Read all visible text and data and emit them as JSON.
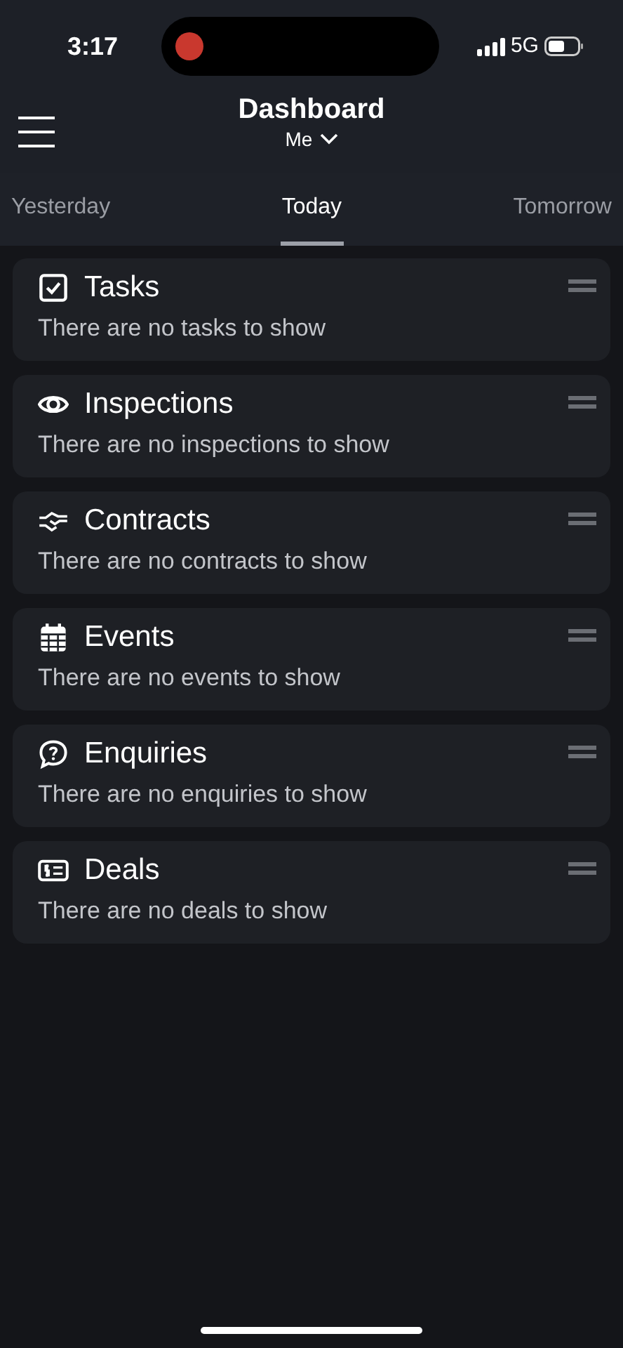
{
  "status_bar": {
    "time": "3:17",
    "network": "5G",
    "recording": true
  },
  "header": {
    "title": "Dashboard",
    "subtitle": "Me"
  },
  "tabs": [
    {
      "label": "Yesterday",
      "selected": false
    },
    {
      "label": "Today",
      "selected": true
    },
    {
      "label": "Tomorrow",
      "selected": false
    }
  ],
  "sections": [
    {
      "kind": "tasks",
      "title": "Tasks",
      "message": "There are no tasks to show"
    },
    {
      "kind": "inspections",
      "title": "Inspections",
      "message": "There are no inspections to show"
    },
    {
      "kind": "contracts",
      "title": "Contracts",
      "message": "There are no contracts to show"
    },
    {
      "kind": "events",
      "title": "Events",
      "message": "There are no events to show"
    },
    {
      "kind": "enquiries",
      "title": "Enquiries",
      "message": "There are no enquiries to show"
    },
    {
      "kind": "deals",
      "title": "Deals",
      "message": "There are no deals to show"
    }
  ]
}
